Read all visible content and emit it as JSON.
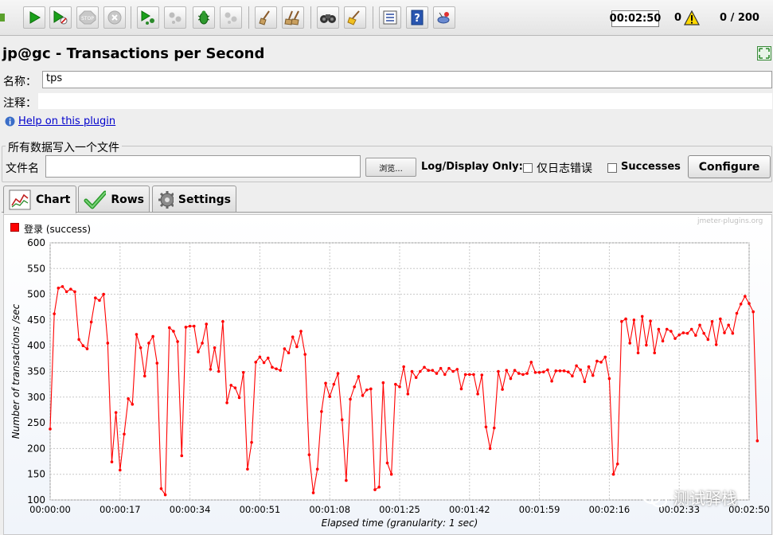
{
  "toolbar": {
    "timer": "00:02:50",
    "error_count": "0",
    "threads": "0 / 200",
    "stop_label": "STOP"
  },
  "header": {
    "title": "jp@gc - Transactions per Second"
  },
  "form": {
    "name_label": "名称：",
    "name_value": "tps",
    "comment_label": "注释：",
    "help_link": "Help on this plugin"
  },
  "file_group": {
    "title": "所有数据写入一个文件",
    "file_label": "文件名",
    "browse_label": "浏览...",
    "log_display_label": "Log/Display Only:",
    "errors_only_label": "仅日志错误",
    "successes_label": "Successes",
    "configure_label": "Configure"
  },
  "tabs": [
    {
      "label": "Chart",
      "active": true
    },
    {
      "label": "Rows",
      "active": false
    },
    {
      "label": "Settings",
      "active": false
    }
  ],
  "watermark": {
    "site": "jmeter-plugins.org",
    "badge": "测试驿栈"
  },
  "colors": {
    "series": "#ff0000",
    "grid": "#c8c8c8"
  },
  "chart_data": {
    "type": "line",
    "xlabel": "Elapsed time (granularity: 1 sec)",
    "ylabel": "Number of transactions /sec",
    "ylim": [
      100,
      600
    ],
    "xlim": [
      0,
      170
    ],
    "yticks": [
      100,
      150,
      200,
      250,
      300,
      350,
      400,
      450,
      500,
      550,
      600
    ],
    "xticks": [
      {
        "t": 0,
        "label": "00:00:00"
      },
      {
        "t": 17,
        "label": "00:00:17"
      },
      {
        "t": 34,
        "label": "00:00:34"
      },
      {
        "t": 51,
        "label": "00:00:51"
      },
      {
        "t": 68,
        "label": "00:01:08"
      },
      {
        "t": 85,
        "label": "00:01:25"
      },
      {
        "t": 102,
        "label": "00:01:42"
      },
      {
        "t": 119,
        "label": "00:01:59"
      },
      {
        "t": 136,
        "label": "00:02:16"
      },
      {
        "t": 153,
        "label": "00:02:33"
      },
      {
        "t": 170,
        "label": "00:02:50"
      }
    ],
    "grid": true,
    "legend": "top-left",
    "series": [
      {
        "name": "登录 (success)",
        "values": [
          238,
          462,
          512,
          515,
          505,
          510,
          505,
          412,
          400,
          394,
          446,
          493,
          488,
          500,
          405,
          174,
          270,
          158,
          228,
          297,
          286,
          422,
          396,
          341,
          405,
          418,
          366,
          122,
          110,
          435,
          428,
          408,
          186,
          436,
          438,
          438,
          388,
          405,
          442,
          354,
          396,
          350,
          447,
          289,
          323,
          318,
          299,
          348,
          160,
          212,
          368,
          378,
          367,
          376,
          358,
          355,
          352,
          394,
          386,
          417,
          398,
          428,
          383,
          188,
          114,
          160,
          272,
          327,
          301,
          325,
          346,
          256,
          138,
          296,
          320,
          340,
          303,
          314,
          316,
          120,
          125,
          328,
          172,
          150,
          325,
          320,
          359,
          306,
          350,
          338,
          350,
          358,
          352,
          352,
          346,
          356,
          344,
          356,
          350,
          354,
          316,
          344,
          344,
          344,
          306,
          343,
          242,
          200,
          240,
          350,
          315,
          352,
          336,
          352,
          346,
          344,
          346,
          368,
          348,
          348,
          349,
          353,
          331,
          351,
          351,
          351,
          349,
          341,
          361,
          353,
          330,
          359,
          342,
          370,
          368,
          378,
          336,
          150,
          170,
          447,
          452,
          405,
          450,
          386,
          457,
          401,
          448,
          386,
          432,
          409,
          432,
          428,
          414,
          421,
          425,
          424,
          432,
          420,
          440,
          424,
          412,
          447,
          402,
          452,
          425,
          440,
          424,
          463,
          481,
          496,
          482,
          466,
          215
        ]
      }
    ]
  }
}
